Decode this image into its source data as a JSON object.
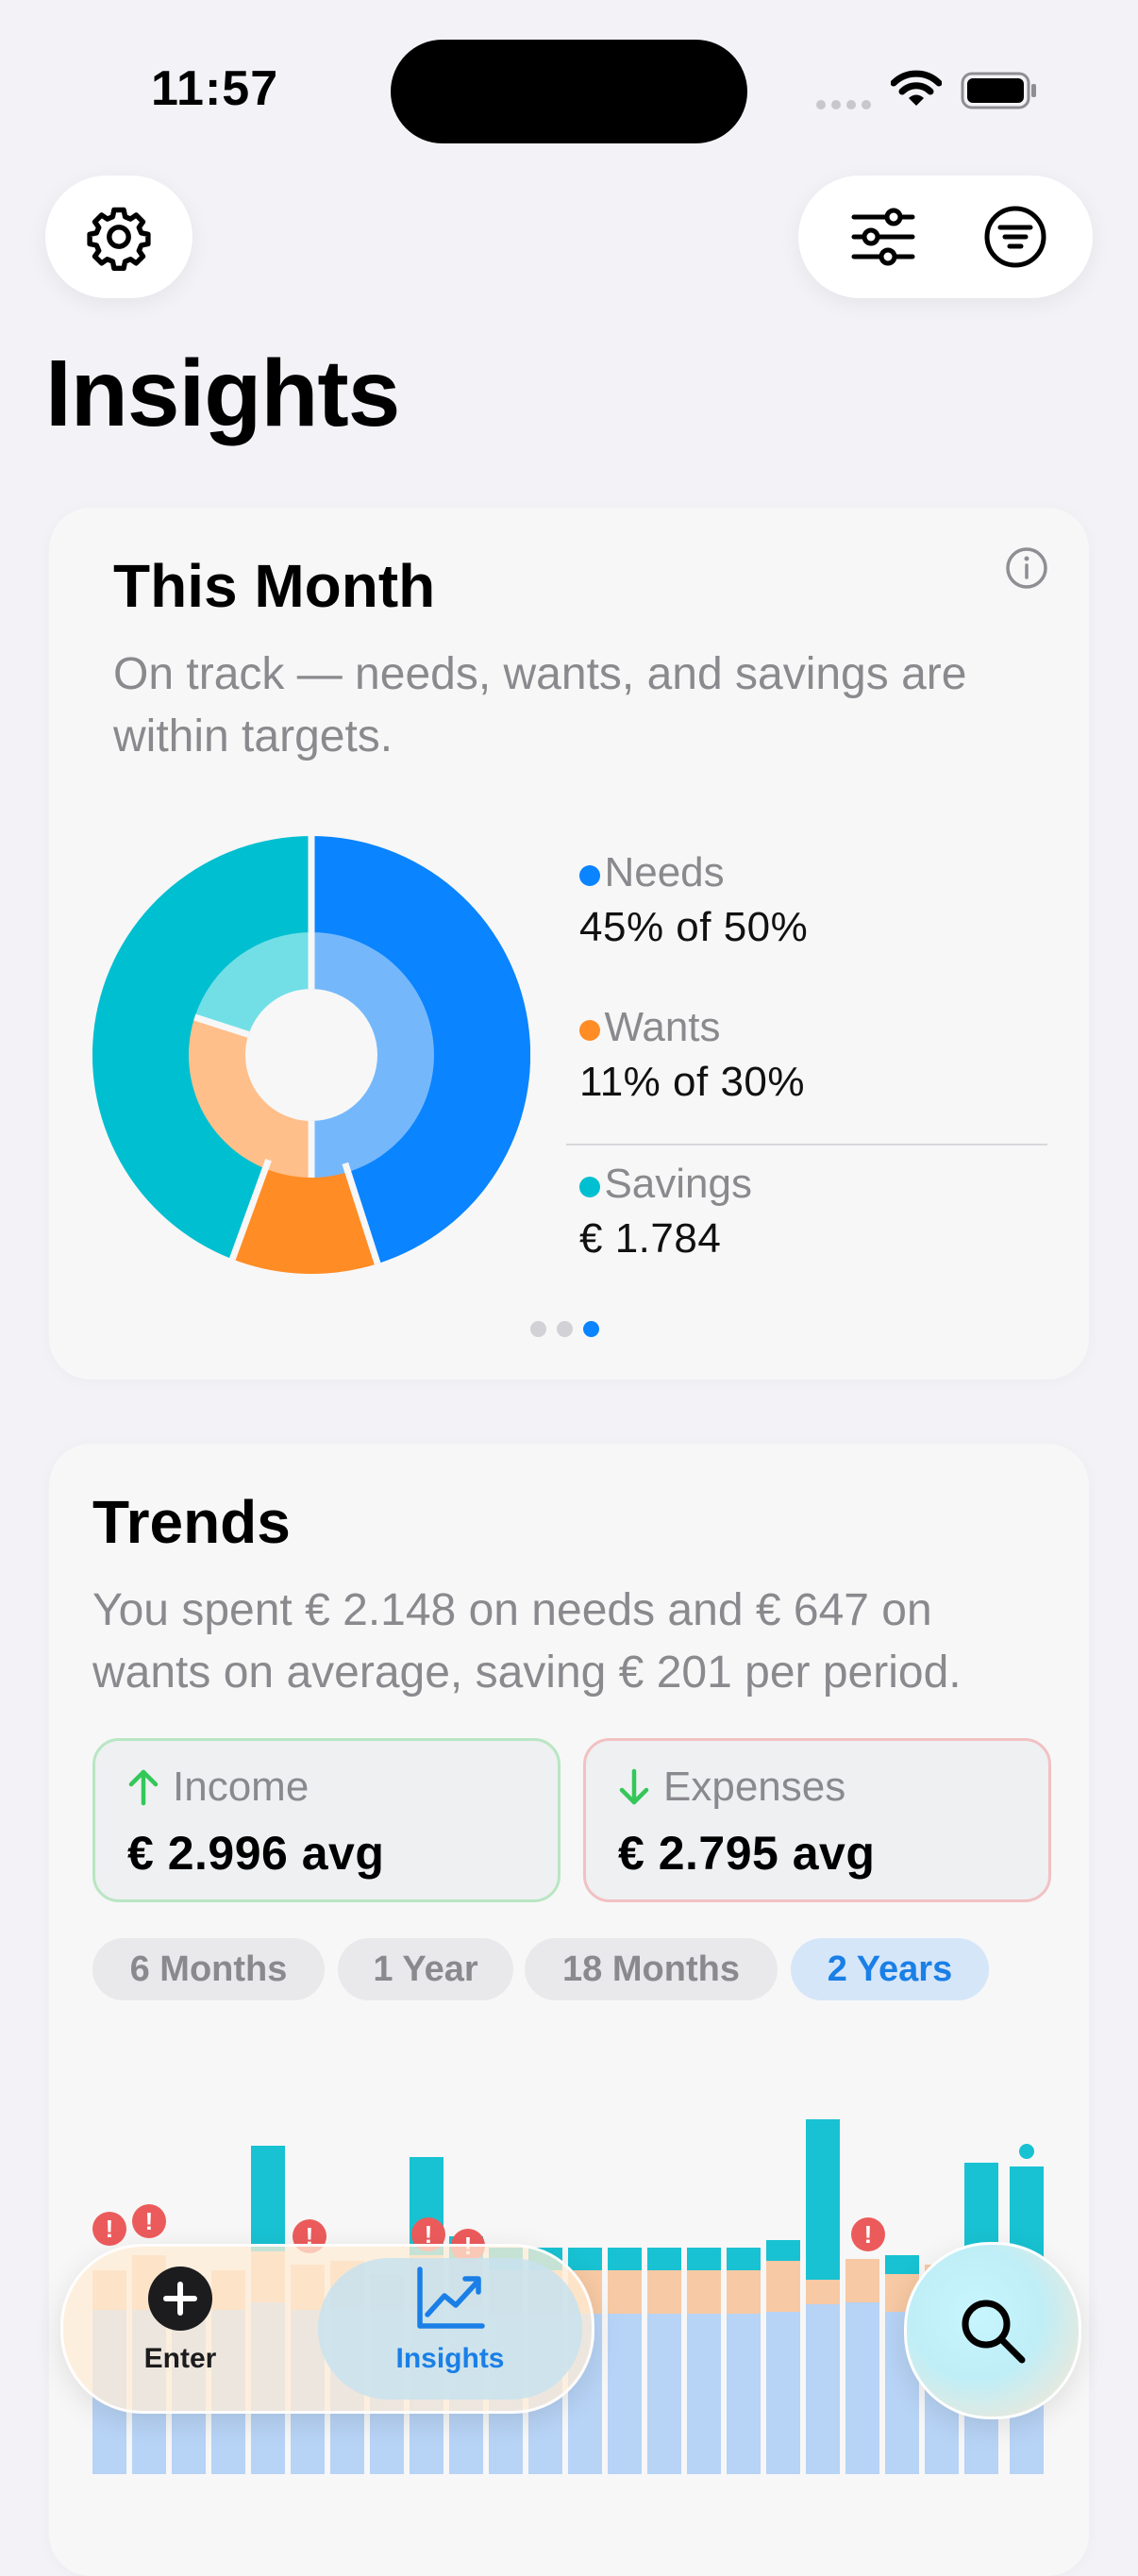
{
  "status_bar": {
    "time": "11:57"
  },
  "header": {
    "title": "Insights"
  },
  "this_month": {
    "title": "This Month",
    "description": "On track — needs, wants, and savings are within targets.",
    "legend": [
      {
        "label": "Needs",
        "value": "45% of 50%",
        "color": "#0a84ff"
      },
      {
        "label": "Wants",
        "value": "11% of 30%",
        "color": "#ff8c24"
      },
      {
        "label": "Savings",
        "value": "€ 1.784",
        "color": "#00bfd0"
      }
    ],
    "page_index": 3,
    "page_count": 3
  },
  "trends": {
    "title": "Trends",
    "description": "You spent € 2.148 on needs and € 647 on wants on average, saving € 201 per period.",
    "income": {
      "label": "Income",
      "value": "€ 2.996 avg",
      "color": "#34c759"
    },
    "expenses": {
      "label": "Expenses",
      "value": "€ 2.795 avg",
      "color": "#ff3b30"
    },
    "ranges": [
      "6 Months",
      "1 Year",
      "18 Months",
      "2 Years"
    ],
    "selected_range": "2 Years",
    "alert_glyph": "!"
  },
  "tab_bar": {
    "tabs": [
      {
        "label": "Enter",
        "icon": "plus-icon"
      },
      {
        "label": "Insights",
        "icon": "chart-trend-icon",
        "selected": true
      }
    ],
    "search_icon": "magnifier-icon"
  }
}
